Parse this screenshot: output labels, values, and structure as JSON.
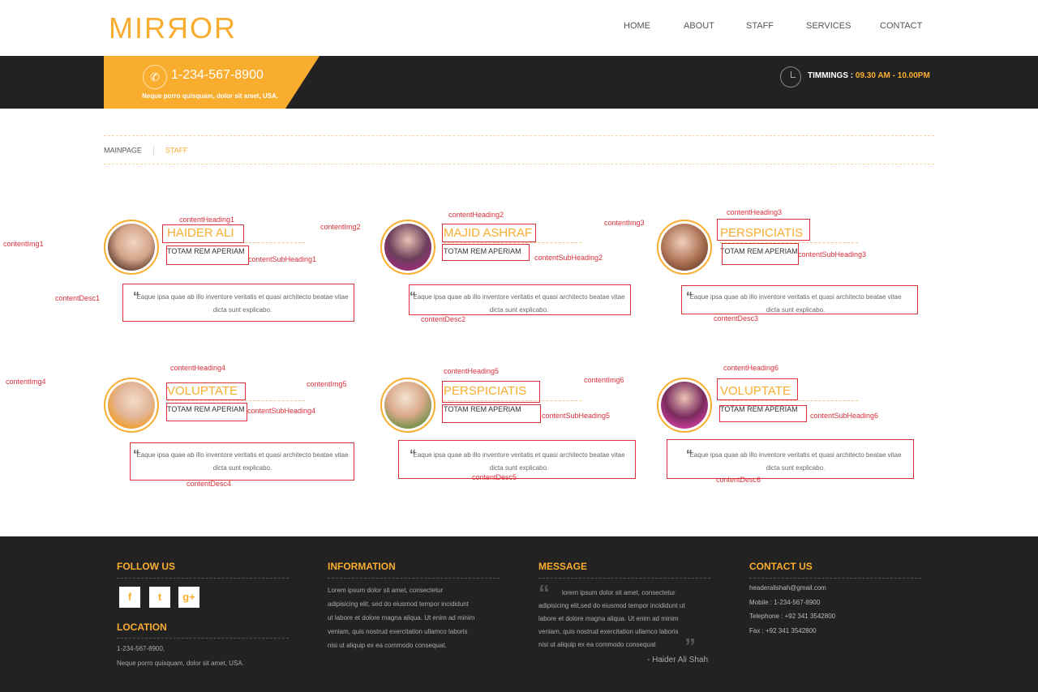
{
  "header": {
    "logo": "MIRЯOR",
    "nav": [
      "HOME",
      "ABOUT",
      "STAFF",
      "SERVICES",
      "CONTACT"
    ]
  },
  "topbar": {
    "phone": "1-234-567-8900",
    "address": "Neque porro quisquam, dolor sit amet, USA.",
    "timings_label": "TIMMINGS : ",
    "timings_value": "09.30 AM - 10.00PM"
  },
  "breadcrumb": {
    "main": "MAINPAGE",
    "current": "STAFF"
  },
  "staff": [
    {
      "name": "HAIDER ALI",
      "role": "TOTAM REM APERIAM",
      "quote": "Eaque ipsa quae ab illo inventore veritatis et quasi architecto beatae vitae dicta sunt explicabo."
    },
    {
      "name": "MAJID ASHRAF",
      "role": "TOTAM REM APERIAM",
      "quote": "Eaque ipsa quae ab illo inventore veritatis et quasi architecto beatae vitae dicta sunt explicabo."
    },
    {
      "name": "PERSPICIATIS",
      "role": "TOTAM REM APERIAM",
      "quote": "Eaque ipsa quae ab illo inventore veritatis et quasi architecto beatae vitae dicta sunt explicabo."
    },
    {
      "name": "VOLUPTATE",
      "role": "TOTAM REM APERIAM",
      "quote": "Eaque ipsa quae ab illo inventore veritatis et quasi architecto beatae vitae dicta sunt explicabo."
    },
    {
      "name": "PERSPICIATIS",
      "role": "TOTAM REM APERIAM",
      "quote": "Eaque ipsa quae ab illo inventore veritatis et quasi architecto beatae vitae dicta sunt explicabo."
    },
    {
      "name": "VOLUPTATE",
      "role": "TOTAM REM APERIAM",
      "quote": "Eaque ipsa quae ab illo inventore veritatis et quasi architecto beatae vitae dicta sunt explicabo."
    }
  ],
  "annotations": {
    "img": [
      "contentImg1",
      "contentImg2",
      "contentImg3",
      "contentImg4",
      "contentImg5",
      "contentImg6"
    ],
    "heading": [
      "contentHeading1",
      "contentHeading2",
      "contentHeading3",
      "contentHeading4",
      "contentHeading5",
      "contentHeading6"
    ],
    "subheading": [
      "contentSubHeading1",
      "contentSubHeading2",
      "contentSubHeading3",
      "contentSubHeading4",
      "contentSubHeading5",
      "contentSubHeading6"
    ],
    "desc": [
      "contentDesc1",
      "contentDesc2",
      "contentDesc3",
      "contentDesc4",
      "contentDesc5",
      "contentDesc6"
    ]
  },
  "footer": {
    "follow_title": "FOLLOW US",
    "social_icons": [
      "facebook-icon",
      "twitter-icon",
      "google-plus-icon"
    ],
    "social_glyphs": [
      "f",
      "t",
      "g+"
    ],
    "location_title": "LOCATION",
    "location_lines": [
      "1-234-567-8900,",
      "Neque porro quisquam, dolor sit amet, USA."
    ],
    "info_title": "INFORMATION",
    "info_lines": [
      "Lorem ipsum dolor sit amet, consectetur",
      "adipisicing elit, sed do eiusmod tempor incididunt",
      "ut labore et dolore magna aliqua. Ut enim ad minim",
      "veniam, quis nostrud exercitation ullamco laboris",
      "nisi ut aliquip ex ea commodo consequat."
    ],
    "message_title": "MESSAGE",
    "message_lines": [
      "lorem ipsum dolor sit amet, consectetur",
      "adipisicing elit,sed do eiusmod tempor incididunt ut",
      "labore et dolore magna aliqua. Ut enim ad minim",
      "veniam, quis nostrud exercitation ullamco laboris",
      "nisi ut aliquip ex ea commodo consequat"
    ],
    "message_author": "- Haider Ali Shah",
    "contact_title": "CONTACT US",
    "contact_lines": [
      "headeralishah@gmail.com",
      "Mobile : 1-234-567-8900",
      "Telephone : +92 341 3542800",
      "Fax : +92 341 3542800"
    ]
  },
  "colors": {
    "accent": "#f9ad2f",
    "dark": "#222222",
    "annotation": "#d6303a"
  }
}
